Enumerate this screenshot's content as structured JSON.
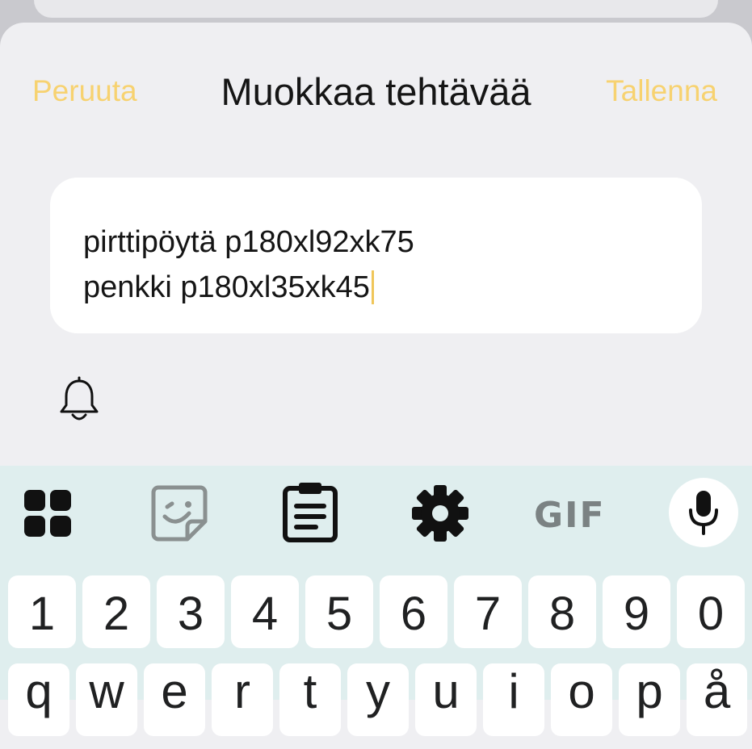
{
  "dialog": {
    "title": "Muokkaa tehtävää",
    "cancel_label": "Peruuta",
    "save_label": "Tallenna",
    "accent_color": "#f7d270"
  },
  "note": {
    "line1": "pirttipöytä p180xl92xk75",
    "line2": "penkki p180xl35xk45"
  },
  "reminder": {
    "icon": "bell-icon"
  },
  "keyboard": {
    "toolbar": {
      "apps_icon": "apps-grid-icon",
      "sticker_icon": "sticker-icon",
      "clipboard_icon": "clipboard-icon",
      "settings_icon": "gear-icon",
      "gif_label": "GIF",
      "mic_icon": "microphone-icon"
    },
    "number_row": [
      "1",
      "2",
      "3",
      "4",
      "5",
      "6",
      "7",
      "8",
      "9",
      "0"
    ],
    "letter_row": [
      "q",
      "w",
      "e",
      "r",
      "t",
      "y",
      "u",
      "i",
      "o",
      "p",
      "å"
    ]
  }
}
